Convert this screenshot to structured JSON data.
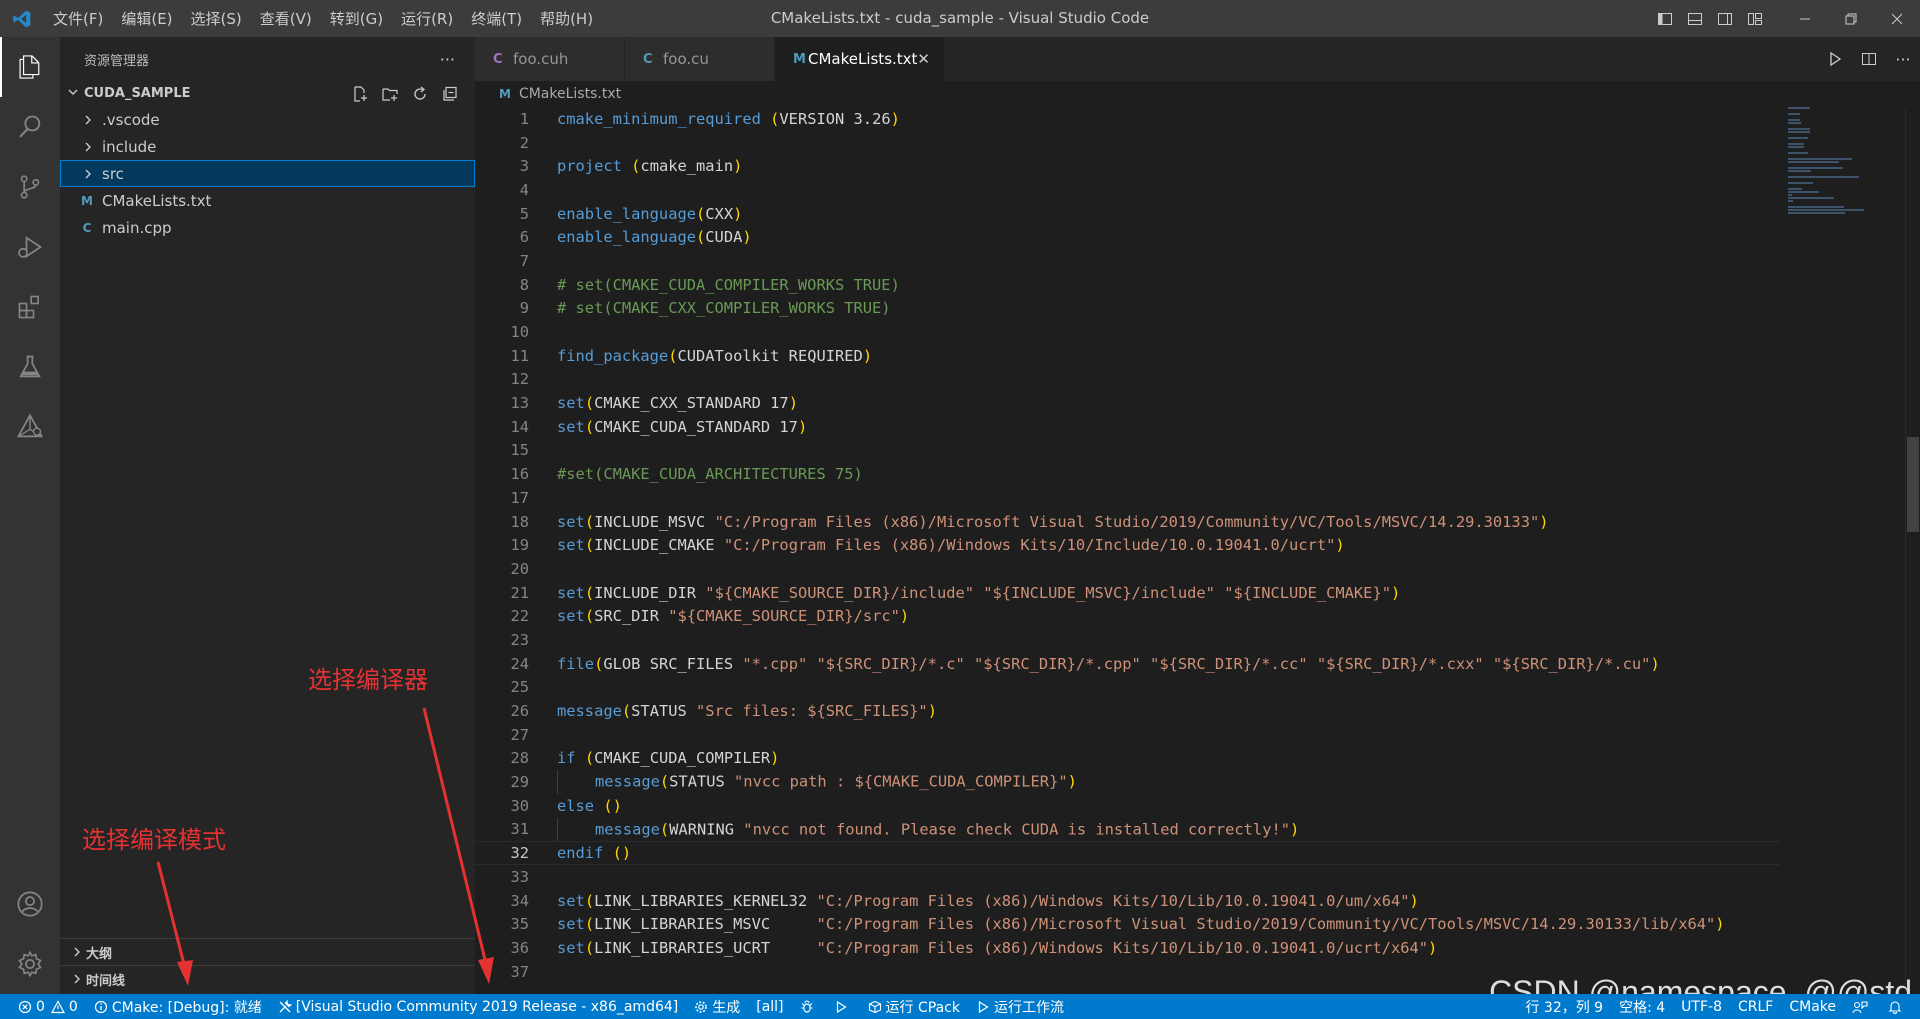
{
  "window": {
    "title": "CMakeLists.txt - cuda_sample - Visual Studio Code"
  },
  "menu": [
    "文件(F)",
    "编辑(E)",
    "选择(S)",
    "查看(V)",
    "转到(G)",
    "运行(R)",
    "终端(T)",
    "帮助(H)"
  ],
  "sidebar": {
    "title": "资源管理器",
    "more": "···",
    "project": "CUDA_SAMPLE",
    "items": [
      {
        "label": ".vscode",
        "type": "folder"
      },
      {
        "label": "include",
        "type": "folder"
      },
      {
        "label": "src",
        "type": "folder",
        "selected": true
      },
      {
        "label": "CMakeLists.txt",
        "type": "cmake"
      },
      {
        "label": "main.cpp",
        "type": "cpp"
      }
    ],
    "outline": "大纲",
    "timeline": "时间线"
  },
  "tabs": [
    {
      "label": "foo.cuh",
      "icon": "C"
    },
    {
      "label": "foo.cu",
      "icon": "C"
    },
    {
      "label": "CMakeLists.txt",
      "icon": "M",
      "active": true,
      "close": "✕"
    }
  ],
  "breadcrumb": {
    "icon": "M",
    "file": "CMakeLists.txt"
  },
  "annotations": {
    "compiler": "选择编译器",
    "mode": "选择编译模式"
  },
  "watermark": "CSDN @namespace_@@std",
  "status": {
    "errors": "0",
    "warnings": "0",
    "cmake_status": "CMake: [Debug]: 就绪",
    "kit": "[Visual Studio Community 2019 Release - x86_amd64]",
    "build": "生成",
    "target": "[all]",
    "cpack": "运行 CPack",
    "workflow": "运行工作流",
    "position": "行 32，列 9",
    "spaces": "空格: 4",
    "encoding": "UTF-8",
    "eol": "CRLF",
    "language": "CMake"
  },
  "code_lines": [
    {
      "n": "1",
      "t": [
        [
          "cmake_minimum_required",
          "fn"
        ],
        [
          " (",
          "par"
        ],
        [
          "VERSION 3.26",
          "var"
        ],
        [
          ")",
          "par"
        ]
      ]
    },
    {
      "n": "2",
      "t": []
    },
    {
      "n": "3",
      "t": [
        [
          "project",
          "fn"
        ],
        [
          " (",
          "par"
        ],
        [
          "cmake_main",
          "var"
        ],
        [
          ")",
          "par"
        ]
      ]
    },
    {
      "n": "4",
      "t": []
    },
    {
      "n": "5",
      "t": [
        [
          "enable_language",
          "fn"
        ],
        [
          "(",
          "par"
        ],
        [
          "CXX",
          "var"
        ],
        [
          ")",
          "par"
        ]
      ]
    },
    {
      "n": "6",
      "t": [
        [
          "enable_language",
          "fn"
        ],
        [
          "(",
          "par"
        ],
        [
          "CUDA",
          "var"
        ],
        [
          ")",
          "par"
        ]
      ]
    },
    {
      "n": "7",
      "t": []
    },
    {
      "n": "8",
      "t": [
        [
          "# set(CMAKE_CUDA_COMPILER_WORKS TRUE)",
          "com"
        ]
      ]
    },
    {
      "n": "9",
      "t": [
        [
          "# set(CMAKE_CXX_COMPILER_WORKS TRUE)",
          "com"
        ]
      ]
    },
    {
      "n": "10",
      "t": []
    },
    {
      "n": "11",
      "t": [
        [
          "find_package",
          "fn"
        ],
        [
          "(",
          "par"
        ],
        [
          "CUDAToolkit REQUIRED",
          "var"
        ],
        [
          ")",
          "par"
        ]
      ]
    },
    {
      "n": "12",
      "t": []
    },
    {
      "n": "13",
      "t": [
        [
          "set",
          "fn"
        ],
        [
          "(",
          "par"
        ],
        [
          "CMAKE_CXX_STANDARD 17",
          "var"
        ],
        [
          ")",
          "par"
        ]
      ]
    },
    {
      "n": "14",
      "t": [
        [
          "set",
          "fn"
        ],
        [
          "(",
          "par"
        ],
        [
          "CMAKE_CUDA_STANDARD 17",
          "var"
        ],
        [
          ")",
          "par"
        ]
      ]
    },
    {
      "n": "15",
      "t": []
    },
    {
      "n": "16",
      "t": [
        [
          "#set(CMAKE_CUDA_ARCHITECTURES 75)",
          "com"
        ]
      ]
    },
    {
      "n": "17",
      "t": []
    },
    {
      "n": "18",
      "t": [
        [
          "set",
          "fn"
        ],
        [
          "(",
          "par"
        ],
        [
          "INCLUDE_MSVC ",
          "var"
        ],
        [
          "\"C:/Program Files (x86)/Microsoft Visual Studio/2019/Community/VC/Tools/MSVC/14.29.30133\"",
          "str"
        ],
        [
          ")",
          "par"
        ]
      ]
    },
    {
      "n": "19",
      "t": [
        [
          "set",
          "fn"
        ],
        [
          "(",
          "par"
        ],
        [
          "INCLUDE_CMAKE ",
          "var"
        ],
        [
          "\"C:/Program Files (x86)/Windows Kits/10/Include/10.0.19041.0/ucrt\"",
          "str"
        ],
        [
          ")",
          "par"
        ]
      ]
    },
    {
      "n": "20",
      "t": []
    },
    {
      "n": "21",
      "t": [
        [
          "set",
          "fn"
        ],
        [
          "(",
          "par"
        ],
        [
          "INCLUDE_DIR ",
          "var"
        ],
        [
          "\"${CMAKE_SOURCE_DIR}/include\" \"${INCLUDE_MSVC}/include\" \"${INCLUDE_CMAKE}\"",
          "str"
        ],
        [
          ")",
          "par"
        ]
      ]
    },
    {
      "n": "22",
      "t": [
        [
          "set",
          "fn"
        ],
        [
          "(",
          "par"
        ],
        [
          "SRC_DIR ",
          "var"
        ],
        [
          "\"${CMAKE_SOURCE_DIR}/src\"",
          "str"
        ],
        [
          ")",
          "par"
        ]
      ]
    },
    {
      "n": "23",
      "t": []
    },
    {
      "n": "24",
      "t": [
        [
          "file",
          "fn"
        ],
        [
          "(",
          "par"
        ],
        [
          "GLOB SRC_FILES ",
          "var"
        ],
        [
          "\"*.cpp\" \"${SRC_DIR}/*.c\" \"${SRC_DIR}/*.cpp\" \"${SRC_DIR}/*.cc\" \"${SRC_DIR}/*.cxx\" \"${SRC_DIR}/*.cu\"",
          "str"
        ],
        [
          ")",
          "par"
        ]
      ]
    },
    {
      "n": "25",
      "t": []
    },
    {
      "n": "26",
      "t": [
        [
          "message",
          "fn"
        ],
        [
          "(",
          "par"
        ],
        [
          "STATUS ",
          "var"
        ],
        [
          "\"Src files: ${SRC_FILES}\"",
          "str"
        ],
        [
          ")",
          "par"
        ]
      ]
    },
    {
      "n": "27",
      "t": []
    },
    {
      "n": "28",
      "t": [
        [
          "if",
          "fn"
        ],
        [
          " (",
          "par"
        ],
        [
          "CMAKE_CUDA_COMPILER",
          "var"
        ],
        [
          ")",
          "par"
        ]
      ]
    },
    {
      "n": "29",
      "indent": true,
      "t": [
        [
          "message",
          "fn"
        ],
        [
          "(",
          "par"
        ],
        [
          "STATUS ",
          "var"
        ],
        [
          "\"nvcc path : ${CMAKE_CUDA_COMPILER}\"",
          "str"
        ],
        [
          ")",
          "par"
        ]
      ]
    },
    {
      "n": "30",
      "t": [
        [
          "else",
          "fn"
        ],
        [
          " ()",
          "par"
        ]
      ]
    },
    {
      "n": "31",
      "indent": true,
      "t": [
        [
          "message",
          "fn"
        ],
        [
          "(",
          "par"
        ],
        [
          "WARNING ",
          "var"
        ],
        [
          "\"nvcc not found. Please check CUDA is installed correctly!\"",
          "str"
        ],
        [
          ")",
          "par"
        ]
      ]
    },
    {
      "n": "32",
      "cur": true,
      "t": [
        [
          "endif",
          "fn"
        ],
        [
          " ()",
          "par"
        ]
      ]
    },
    {
      "n": "33",
      "t": []
    },
    {
      "n": "34",
      "t": [
        [
          "set",
          "fn"
        ],
        [
          "(",
          "par"
        ],
        [
          "LINK_LIBRARIES_KERNEL32 ",
          "var"
        ],
        [
          "\"C:/Program Files (x86)/Windows Kits/10/Lib/10.0.19041.0/um/x64\"",
          "str"
        ],
        [
          ")",
          "par"
        ]
      ]
    },
    {
      "n": "35",
      "t": [
        [
          "set",
          "fn"
        ],
        [
          "(",
          "par"
        ],
        [
          "LINK_LIBRARIES_MSVC     ",
          "var"
        ],
        [
          "\"C:/Program Files (x86)/Microsoft Visual Studio/2019/Community/VC/Tools/MSVC/14.29.30133/lib/x64\"",
          "str"
        ],
        [
          ")",
          "par"
        ]
      ]
    },
    {
      "n": "36",
      "t": [
        [
          "set",
          "fn"
        ],
        [
          "(",
          "par"
        ],
        [
          "LINK_LIBRARIES_UCRT     ",
          "var"
        ],
        [
          "\"C:/Program Files (x86)/Windows Kits/10/Lib/10.0.19041.0/ucrt/x64\"",
          "str"
        ],
        [
          ")",
          "par"
        ]
      ]
    },
    {
      "n": "37",
      "t": []
    }
  ],
  "colors": {
    "accent": "#007acc",
    "annotation": "#e43232"
  },
  "icons": [
    "vscode-logo-icon",
    "explorer-icon",
    "search-icon",
    "source-control-icon",
    "run-debug-icon",
    "extensions-icon",
    "testing-icon",
    "cmake-icon",
    "account-icon",
    "settings-gear-icon"
  ]
}
